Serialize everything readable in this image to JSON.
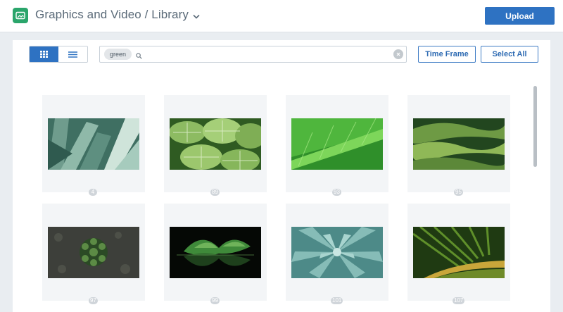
{
  "header": {
    "title": "Graphics and Video / Library",
    "upload_label": "Upload"
  },
  "toolbar": {
    "view_mode": "grid",
    "search": {
      "chip": "green",
      "value": "",
      "placeholder": ""
    },
    "time_frame_label": "Time Frame",
    "select_all_label": "Select All"
  },
  "library": {
    "items": [
      {
        "label": "4",
        "image": "agave leaves"
      },
      {
        "label": "89",
        "image": "veined leaves"
      },
      {
        "label": "93",
        "image": "leaf close-up"
      },
      {
        "label": "95",
        "image": "green hills"
      },
      {
        "label": "97",
        "image": "succulents on gravel"
      },
      {
        "label": "99",
        "image": "plant reflection"
      },
      {
        "label": "101",
        "image": "succulent rosette"
      },
      {
        "label": "107",
        "image": "palm frond"
      }
    ]
  },
  "colors": {
    "accent": "#2e72c2",
    "brand": "#2aa56b"
  }
}
